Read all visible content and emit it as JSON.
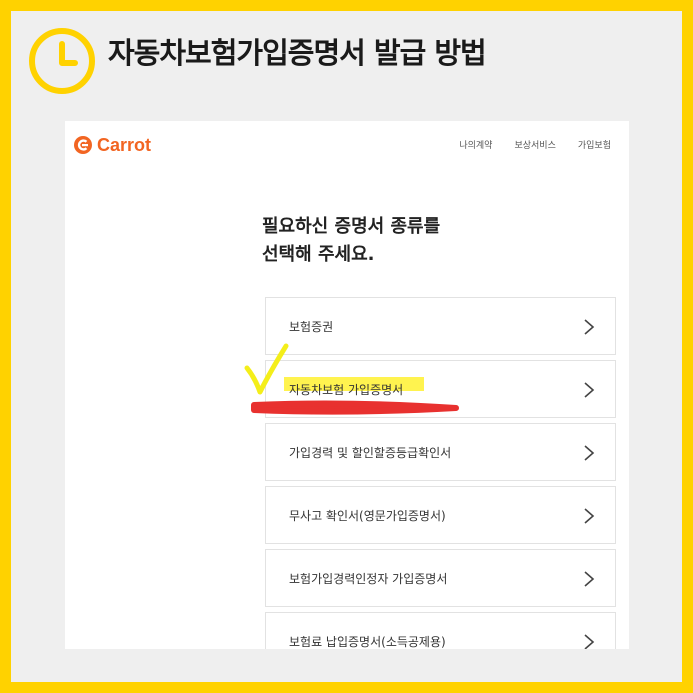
{
  "headline": "자동차보험가입증명서 발급 방법",
  "icons": {
    "clock": "clock-icon",
    "logo": "carrot-logo-icon",
    "chevron": "chevron-right-icon",
    "check": "checkmark-icon"
  },
  "colors": {
    "background": "#ffd200",
    "brand": "#f26522",
    "highlight": "#fff23c",
    "underline": "#e8312f"
  },
  "app": {
    "logo_text": "Carrot",
    "nav": [
      "나의계약",
      "보상서비스",
      "가입보험"
    ]
  },
  "heading": {
    "line1": "필요하신 증명서 종류를",
    "line2": "선택해 주세요."
  },
  "certificates": [
    {
      "label": "보험증권"
    },
    {
      "label": "자동차보험 가입증명서"
    },
    {
      "label": "가입경력 및 할인할증등급확인서"
    },
    {
      "label": "무사고 확인서(영문가입증명서)"
    },
    {
      "label": "보험가입경력인정자 가입증명서"
    },
    {
      "label": "보험료 납입증명서(소득공제용)"
    }
  ]
}
